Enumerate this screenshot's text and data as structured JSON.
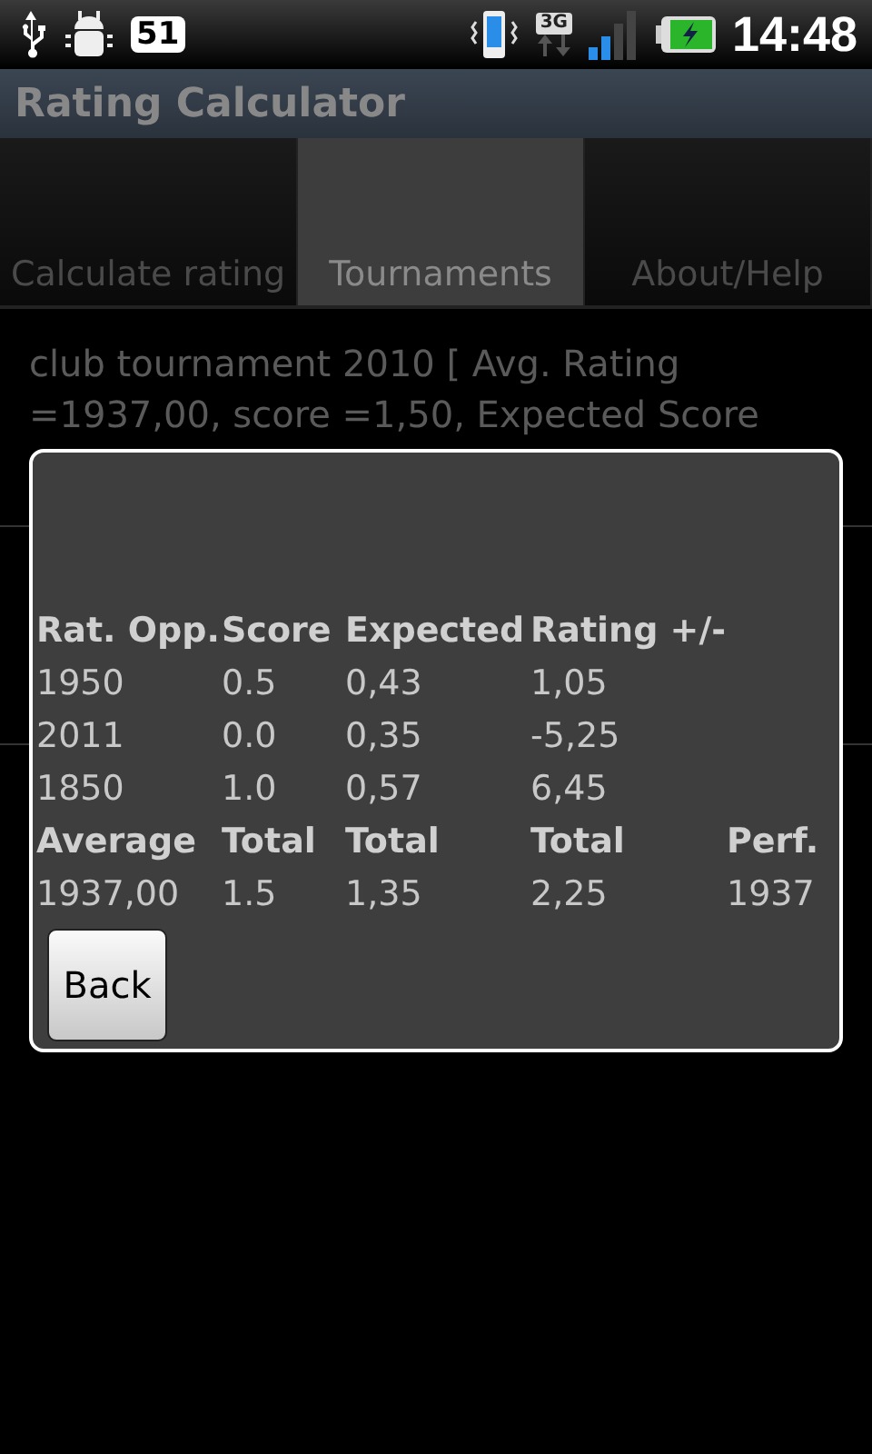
{
  "status_bar": {
    "notification_count": "51",
    "network": "3G",
    "time": "14:48"
  },
  "title_bar": {
    "title": "Rating Calculator"
  },
  "tabs": [
    {
      "label": "Calculate rating",
      "selected": false
    },
    {
      "label": "Tournaments",
      "selected": true
    },
    {
      "label": "About/Help",
      "selected": false
    }
  ],
  "list_items": [
    {
      "text": "club tournament 2010 [ Avg. Rating =1937,00, score =1,50, Expected Score"
    }
  ],
  "dialog": {
    "table": {
      "columns": [
        "Rat. Opp.",
        "Score",
        "Expected",
        "Rating +/-"
      ],
      "rows": [
        [
          "1950",
          "0.5",
          "0,43",
          "1,05"
        ],
        [
          "2011",
          "0.0",
          "0,35",
          "-5,25"
        ],
        [
          "1850",
          "1.0",
          "0,57",
          "6,45"
        ]
      ],
      "summary_labels": [
        "Average",
        "Total",
        "Total",
        "Total",
        "Perf."
      ],
      "summary_values": [
        "1937,00",
        "1.5",
        "1,35",
        "2,25",
        "1937"
      ]
    },
    "button": "Back"
  }
}
